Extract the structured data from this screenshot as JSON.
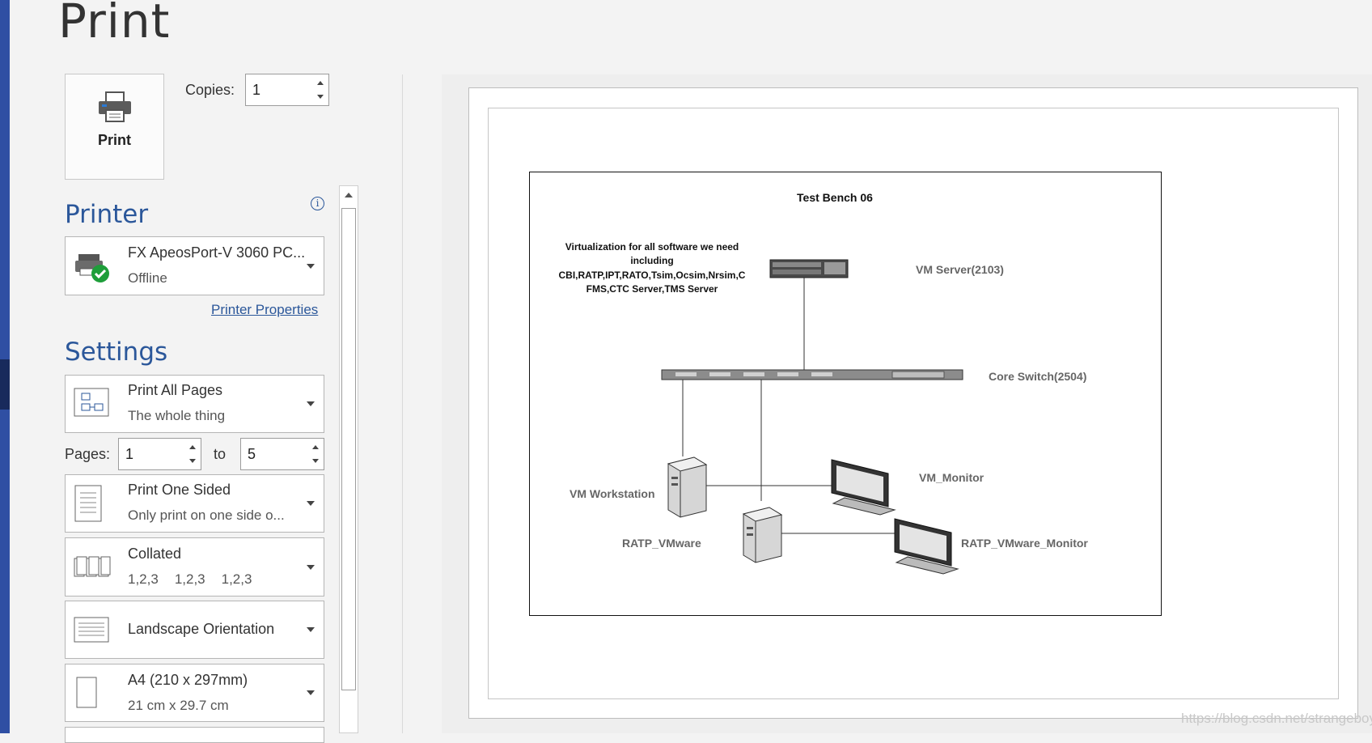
{
  "page": {
    "title": "Print"
  },
  "print_button": {
    "label": "Print"
  },
  "copies": {
    "label": "Copies:",
    "value": "1"
  },
  "printer": {
    "section_title": "Printer",
    "info_icon": "info-icon",
    "name": "FX ApeosPort-V 3060 PC...",
    "status": "Offline",
    "properties_link": "Printer Properties"
  },
  "settings": {
    "section_title": "Settings",
    "print_range": {
      "title": "Print All Pages",
      "subtitle": "The whole thing"
    },
    "pages": {
      "label": "Pages:",
      "from": "1",
      "to_label": "to",
      "to": "5"
    },
    "sides": {
      "title": "Print One Sided",
      "subtitle": "Only print on one side o..."
    },
    "collation": {
      "title": "Collated",
      "subtitle": [
        "1,2,3",
        "1,2,3",
        "1,2,3"
      ]
    },
    "orientation": {
      "title": "Landscape Orientation"
    },
    "paper": {
      "title": "A4 (210 x 297mm)",
      "subtitle": "21 cm x 29.7 cm"
    }
  },
  "preview": {
    "diagram": {
      "title": "Test Bench 06",
      "note_lines": [
        "Virtualization for all software we need",
        "including",
        "CBI,RATP,IPT,RATO,Tsim,Ocsim,Nrsim,C",
        "FMS,CTC Server,TMS Server"
      ],
      "vm_server": "VM Server(2103)",
      "core_switch": "Core Switch(2504)",
      "vm_workstation": "VM Workstation",
      "vm_monitor": "VM_Monitor",
      "ratp_vmware": "RATP_VMware",
      "ratp_monitor": "RATP_VMware_Monitor"
    },
    "watermark": "https://blog.csdn.net/strangeboy"
  },
  "colors": {
    "accent": "#2b579a",
    "left_bar": "#2f4fa3",
    "status_ok": "#1e9e3a"
  }
}
